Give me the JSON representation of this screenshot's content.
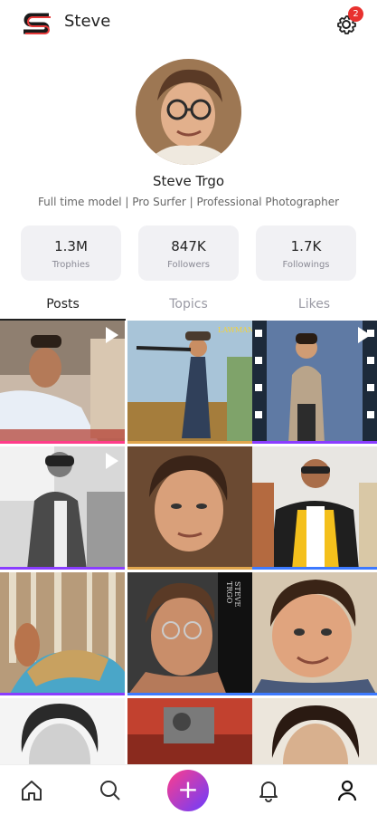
{
  "header": {
    "title": "Steve",
    "notification_count": "2",
    "logo_icon": "s-logo-icon",
    "settings_icon": "gear-icon"
  },
  "profile": {
    "name": "Steve Trgo",
    "bio": "Full time model | Pro Surfer | Professional Photographer"
  },
  "stats": [
    {
      "value": "1.3M",
      "label": "Trophies"
    },
    {
      "value": "847K",
      "label": "Followers"
    },
    {
      "value": "1.7K",
      "label": "Followings"
    }
  ],
  "tabs": [
    {
      "label": "Posts"
    },
    {
      "label": "Topics"
    },
    {
      "label": "Likes"
    }
  ],
  "posts": [
    {
      "caption": "",
      "video": true
    },
    {
      "caption": "LAWMAN",
      "video": false
    },
    {
      "caption": "",
      "video": true
    },
    {
      "caption": "",
      "video": true
    },
    {
      "caption": "",
      "video": false
    },
    {
      "caption": "",
      "video": false
    },
    {
      "caption": "",
      "video": false
    },
    {
      "caption": "STEVE TRGO",
      "video": false
    },
    {
      "caption": "",
      "video": false
    },
    {
      "caption": "",
      "video": false
    },
    {
      "caption": "",
      "video": false
    },
    {
      "caption": "",
      "video": false
    }
  ],
  "bottom_nav": [
    "home-icon",
    "search-icon",
    "add-icon",
    "bell-icon",
    "profile-icon"
  ],
  "colors": {
    "accent_start": "#ff3d8a",
    "accent_end": "#6a3dff",
    "badge": "#e8312f"
  }
}
